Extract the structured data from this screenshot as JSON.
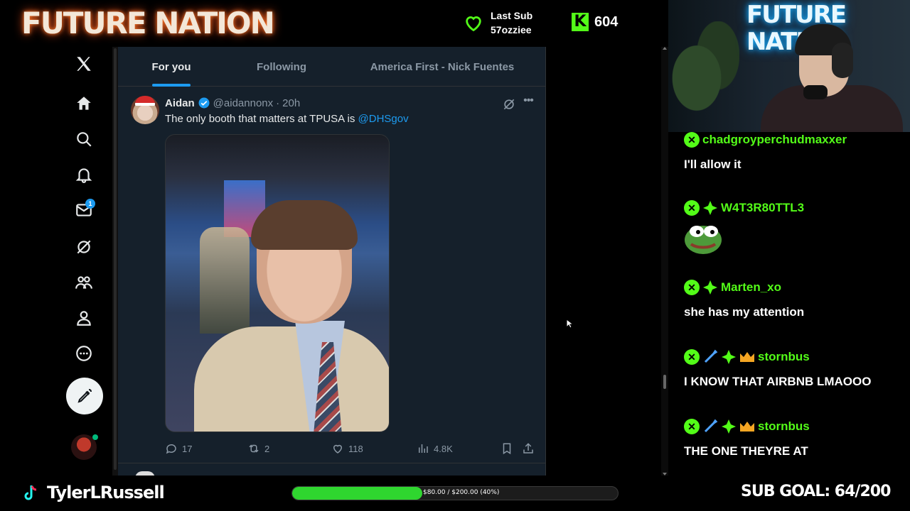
{
  "overlay": {
    "brand": "FUTURE NATION",
    "last_sub_label": "Last Sub",
    "last_sub_user": "57ozziee",
    "kick_logo": "K",
    "viewer_count": "604",
    "streamer_name": "TylerLRussell",
    "goal_progress_text": "$80.00 / $200.00 (40%)",
    "goal_progress_fraction": 0.4,
    "sub_goal": "SUB GOAL: 64/200",
    "cam_sign": "FUTURE NATION",
    "accent_color": "#53fc18"
  },
  "nav": {
    "items": [
      {
        "icon": "x-logo-icon"
      },
      {
        "icon": "home-icon"
      },
      {
        "icon": "search-icon"
      },
      {
        "icon": "notifications-icon"
      },
      {
        "icon": "messages-icon",
        "badge": "1"
      },
      {
        "icon": "grok-icon"
      },
      {
        "icon": "communities-icon"
      },
      {
        "icon": "profile-icon"
      },
      {
        "icon": "more-icon"
      }
    ],
    "post_button_icon": "compose-icon"
  },
  "feed": {
    "tabs": [
      {
        "label": "For you",
        "active": true
      },
      {
        "label": "Following",
        "active": false
      },
      {
        "label": "America First - Nick Fuentes",
        "active": false
      }
    ],
    "tweet": {
      "name": "Aidan",
      "handle": "@aidannonx",
      "dot": "·",
      "time": "20h",
      "text": "The only booth that matters at TPUSA is ",
      "mention": "@DHSgov",
      "replies": "17",
      "reposts": "2",
      "likes": "118",
      "views": "4.8K"
    }
  },
  "chat": {
    "messages": [
      {
        "user": "chadgroyperchudmaxxer",
        "text": "I'll allow it",
        "badges": [
          "mod"
        ]
      },
      {
        "user": "W4T3R80TTL3",
        "text": "",
        "emote": "pepe",
        "badges": [
          "mod",
          "sub"
        ]
      },
      {
        "user": "Marten_xo",
        "text": "she has my attention",
        "badges": [
          "mod",
          "sub"
        ]
      },
      {
        "user": "stornbus",
        "text": "I KNOW THAT AIRBNB LMAOOO",
        "badges": [
          "mod",
          "sword",
          "sub",
          "crown"
        ]
      },
      {
        "user": "stornbus",
        "text": "THE ONE THEYRE AT",
        "badges": [
          "mod",
          "sword",
          "sub",
          "crown"
        ]
      }
    ]
  }
}
